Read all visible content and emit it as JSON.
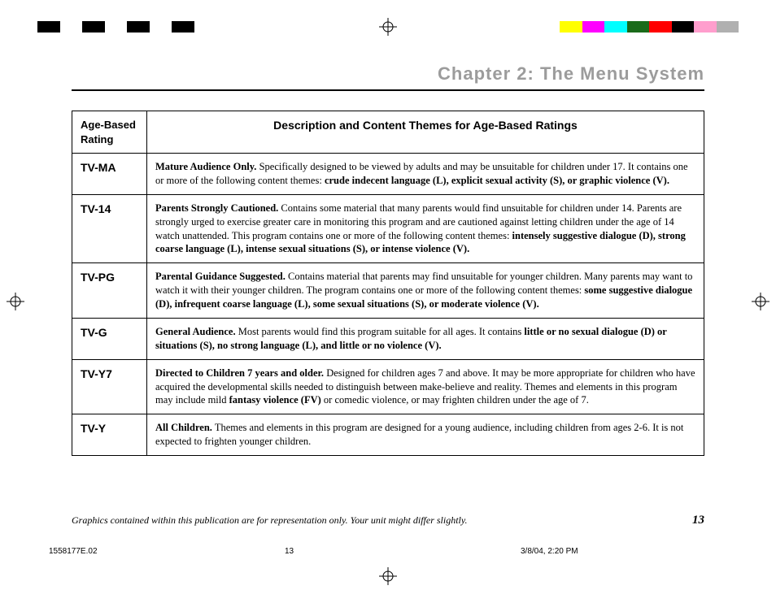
{
  "colors_left": [
    "#000000",
    "#ffffff",
    "#000000",
    "#ffffff",
    "#000000",
    "#ffffff",
    "#000000",
    "#ffffff"
  ],
  "colors_right": [
    "#ffff00",
    "#ff00ff",
    "#00ffff",
    "#1a6b1a",
    "#ff0000",
    "#000000",
    "#ff9ecd",
    "#b0b0b0"
  ],
  "chapter_title": "Chapter 2: The Menu System",
  "header_rating": "Age-Based Rating",
  "header_desc": "Description and Content Themes for Age-Based Ratings",
  "rows": [
    {
      "rating": "TV-MA",
      "lead": "Mature Audience Only.",
      "body": " Specifically designed to be viewed by adults and may be unsuitable for children under 17.  It contains one or more of the following content themes:  ",
      "tail_bold": "crude indecent language (L), explicit sexual activity (S), or graphic violence (V)."
    },
    {
      "rating": "TV-14",
      "lead": "Parents Strongly Cautioned.",
      "body": " Contains some material that many parents would find unsuitable for children under 14.  Parents are strongly urged to exercise greater care in monitoring this program and are cautioned against letting children under the age of 14 watch unattended.  This program contains one or more of the following content themes:  ",
      "tail_bold": "intensely suggestive dialogue (D), strong coarse language (L), intense sexual situations (S), or intense violence (V)."
    },
    {
      "rating": "TV-PG",
      "lead": "Parental Guidance Suggested.",
      "body": " Contains material that parents may find unsuitable for younger children.  Many parents may want to watch it with their younger children.  The program contains one or more of the following content themes:  ",
      "tail_bold": "some suggestive dialogue (D), infrequent coarse language (L), some sexual situations (S), or moderate violence (V)."
    },
    {
      "rating": "TV-G",
      "lead": "General Audience.",
      "body": " Most parents would find this program suitable for all ages.  It contains ",
      "tail_bold": "little or no sexual dialogue (D) or situations (S), no strong language (L), and little or no violence (V)."
    },
    {
      "rating": "TV-Y7",
      "lead": "Directed to Children 7 years and older.",
      "body": " Designed for children ages 7 and above.  It may be more appropriate for children who have acquired the developmental skills needed to distinguish between make-believe and reality.  Themes and elements in this program may include mild ",
      "tail_bold": "fantasy violence (FV)",
      "after": " or comedic violence, or may frighten children under the age of 7."
    },
    {
      "rating": "TV-Y",
      "lead": "All Children.",
      "body": " Themes and elements in this program are designed for a young audience, including children from ages 2-6.  It is not expected to frighten younger children.",
      "tail_bold": ""
    }
  ],
  "footer_note": "Graphics contained within this publication are for representation only. Your unit might differ slightly.",
  "page_number": "13",
  "slug_doc": "1558177E.02",
  "slug_page": "13",
  "slug_time": "3/8/04, 2:20 PM"
}
